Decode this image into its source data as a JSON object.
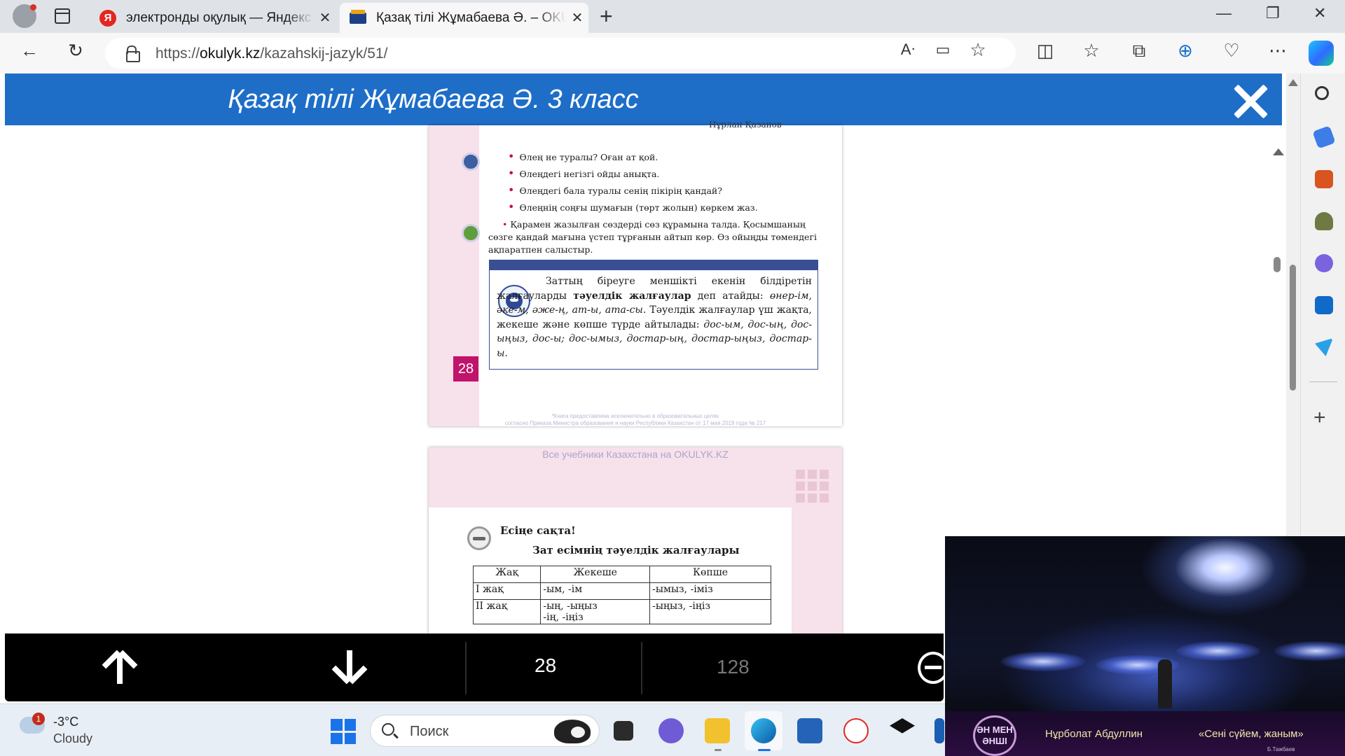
{
  "browser": {
    "tabs": [
      {
        "title": "электронды оқулық — Яндекс: н",
        "favicon": "yandex-icon"
      },
      {
        "title": "Қазақ тілі Жұмабаева Ә. – OKUL",
        "favicon": "book-icon"
      }
    ],
    "url_prefix": "https://",
    "url_domain": "okulyk.kz",
    "url_path": "/kazahskij-jazyk/51/"
  },
  "viewer": {
    "title": "Қазақ тілі Жұмабаева Ә. 3 класс",
    "current_page": "28",
    "total_pages": "128"
  },
  "page1": {
    "cut_top": "Нұрлан Қазанов",
    "bullets": [
      "Өлең не туралы? Оған ат қой.",
      "Өлеңдегі негізгі ойды анықта.",
      "Өлеңдегі бала туралы сенің пікірің қандай?",
      "Өлеңнің соңғы шумағын (төрт жолын) көркем жаз."
    ],
    "task": "Қарамен жазылған сөздерді сөз құрамына талда. Қосымшаның сөзге қандай мағына үстеп тұрғанын айтып көр. Өз ойыңды төмендегі ақпаратпен салыстыр.",
    "rule_t1": "Заттың біреуге меншікті екенін білдіретін жалғауларды ",
    "rule_bold": "тәуелдік жалғаулар",
    "rule_t2": " деп атайды: ",
    "rule_ex1": "өнер-ім, әке-м, әже-ң, ат-ы, ата-сы",
    "rule_t3": ". Тәуелдік жалғаулар үш жақта, жекеше және көпше түрде айтылады: ",
    "rule_ex2": "дос-ым, дос-ың, дос-ыңыз, дос-ы; дос-ымыз, достар-ың, достар-ыңыз, достар-ы",
    "rule_end": ".",
    "page_number": "28",
    "footnote1": "*Книга предоставлена исключительно в образовательных целях",
    "footnote2": "согласно Приказа Министра образования и науки Республики Казахстан от 17 мая 2019 года № 217"
  },
  "page2": {
    "watermark": "Все учебники Казахстана на OKULYK.KZ",
    "remember": "Есіңе сақта!",
    "table_title": "Зат есімнің тәуелдік жалғаулары",
    "table_headers": [
      "Жақ",
      "Жекеше",
      "Көпше"
    ],
    "rows": [
      {
        "c1": "I жақ",
        "c2": "-ым, -ім",
        "c3": "-ымыз, -іміз"
      },
      {
        "c1": "II жақ",
        "c2": "-ың, -ыңыз",
        "c2b": "-ің, -іңіз",
        "c3": "-ыңыз, -іңіз"
      }
    ]
  },
  "taskbar": {
    "weather_badge": "1",
    "temp": "-3°C",
    "condition": "Cloudy",
    "search_placeholder": "Поиск"
  },
  "video": {
    "logo": "ӘН МЕН ӘНШІ",
    "artist": "Нұрболат Абдуллин",
    "song": "«Сені сүйем, жаным»",
    "credit": "Б.Тажбаев"
  },
  "colors": {
    "header_blue": "#1e6ec8",
    "page_pink": "#f7e1ea",
    "page_number_magenta": "#c1136a",
    "rule_box_navy": "#3a4f93"
  }
}
